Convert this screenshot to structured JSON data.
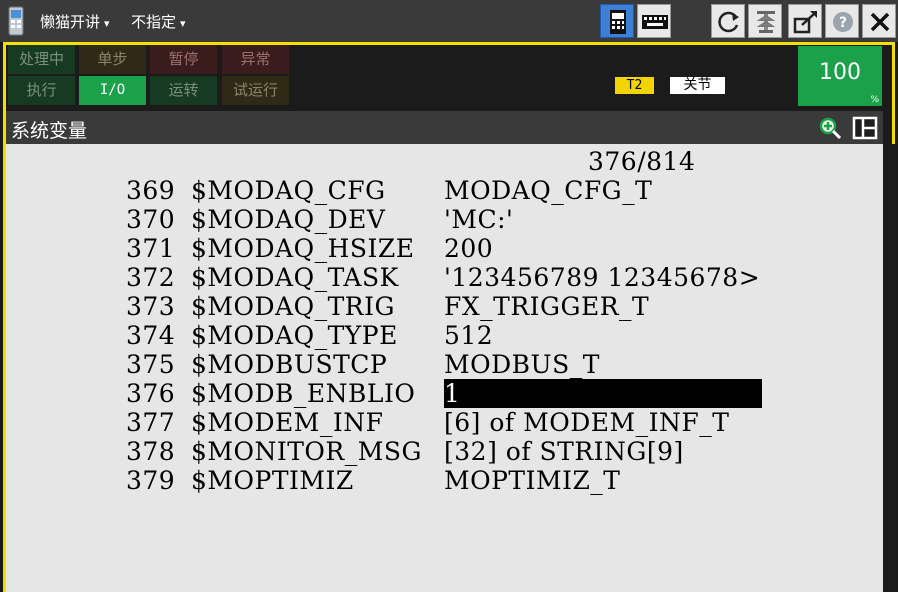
{
  "topbar": {
    "menu1": "懒猫开讲",
    "menu2": "不指定",
    "arrow": "▾"
  },
  "status": {
    "processing": "处理中",
    "single_step": "单步",
    "pause": "暂停",
    "abnormal": "异常",
    "execute": "执行",
    "io": "I/O",
    "running": "运转",
    "trial_run": "试运行",
    "mode": "T2",
    "coord": "关节",
    "override": "100",
    "override_unit": "%"
  },
  "screen": {
    "title": "系统变量",
    "page_counter": "376/814"
  },
  "rows": [
    {
      "num": "369",
      "name": "$MODAQ_CFG",
      "value": "MODAQ_CFG_T"
    },
    {
      "num": "370",
      "name": "$MODAQ_DEV",
      "value": "'MC:'"
    },
    {
      "num": "371",
      "name": "$MODAQ_HSIZE",
      "value": "200"
    },
    {
      "num": "372",
      "name": "$MODAQ_TASK",
      "value": "'123456789 12345678>"
    },
    {
      "num": "373",
      "name": "$MODAQ_TRIG",
      "value": "FX_TRIGGER_T"
    },
    {
      "num": "374",
      "name": "$MODAQ_TYPE",
      "value": "512"
    },
    {
      "num": "375",
      "name": "$MODBUSTCP",
      "value": "MODBUS_T"
    },
    {
      "num": "376",
      "name": "$MODB_ENBLIO",
      "value": "1"
    },
    {
      "num": "377",
      "name": "$MODEM_INF",
      "value": "[6] of MODEM_INF_T"
    },
    {
      "num": "378",
      "name": "$MONITOR_MSG",
      "value": "[32] of STRING[9]"
    },
    {
      "num": "379",
      "name": "$MOPTIMIZ",
      "value": "MOPTIMIZ_T"
    }
  ],
  "colors": {
    "frame": "#f3e000",
    "green": "#1aa14a",
    "content_bg": "#e6e6e6",
    "selected_bg": "#000000"
  }
}
